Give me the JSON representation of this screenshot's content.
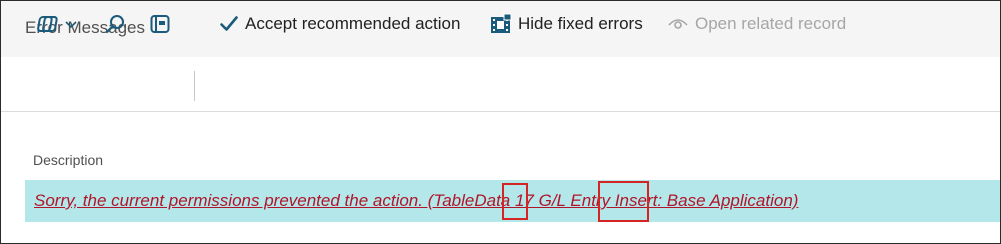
{
  "window": {
    "title": "Error Messages"
  },
  "toolbar": {
    "accept_label": "Accept recommended action",
    "hide_fixed_label": "Hide fixed errors",
    "open_related_label": "Open related record"
  },
  "icons": {
    "page_switch": "view-switch-icon",
    "chevron": "chevron-down-icon",
    "search": "search-icon",
    "filter_pane": "filter-pane-icon",
    "accept": "checkmark-icon",
    "hide_fixed": "film-strip-icon",
    "open_related": "eye-icon"
  },
  "table": {
    "columns": [
      "Description"
    ],
    "rows": [
      {
        "description": "Sorry, the current permissions prevented the action. (TableData 17 G/L Entry Insert: Base Application)"
      }
    ]
  },
  "colors": {
    "accent": "#1a5a7a",
    "selected_row": "#b3e7e9",
    "error_text": "#b1152a",
    "highlight_box": "#d42424"
  }
}
